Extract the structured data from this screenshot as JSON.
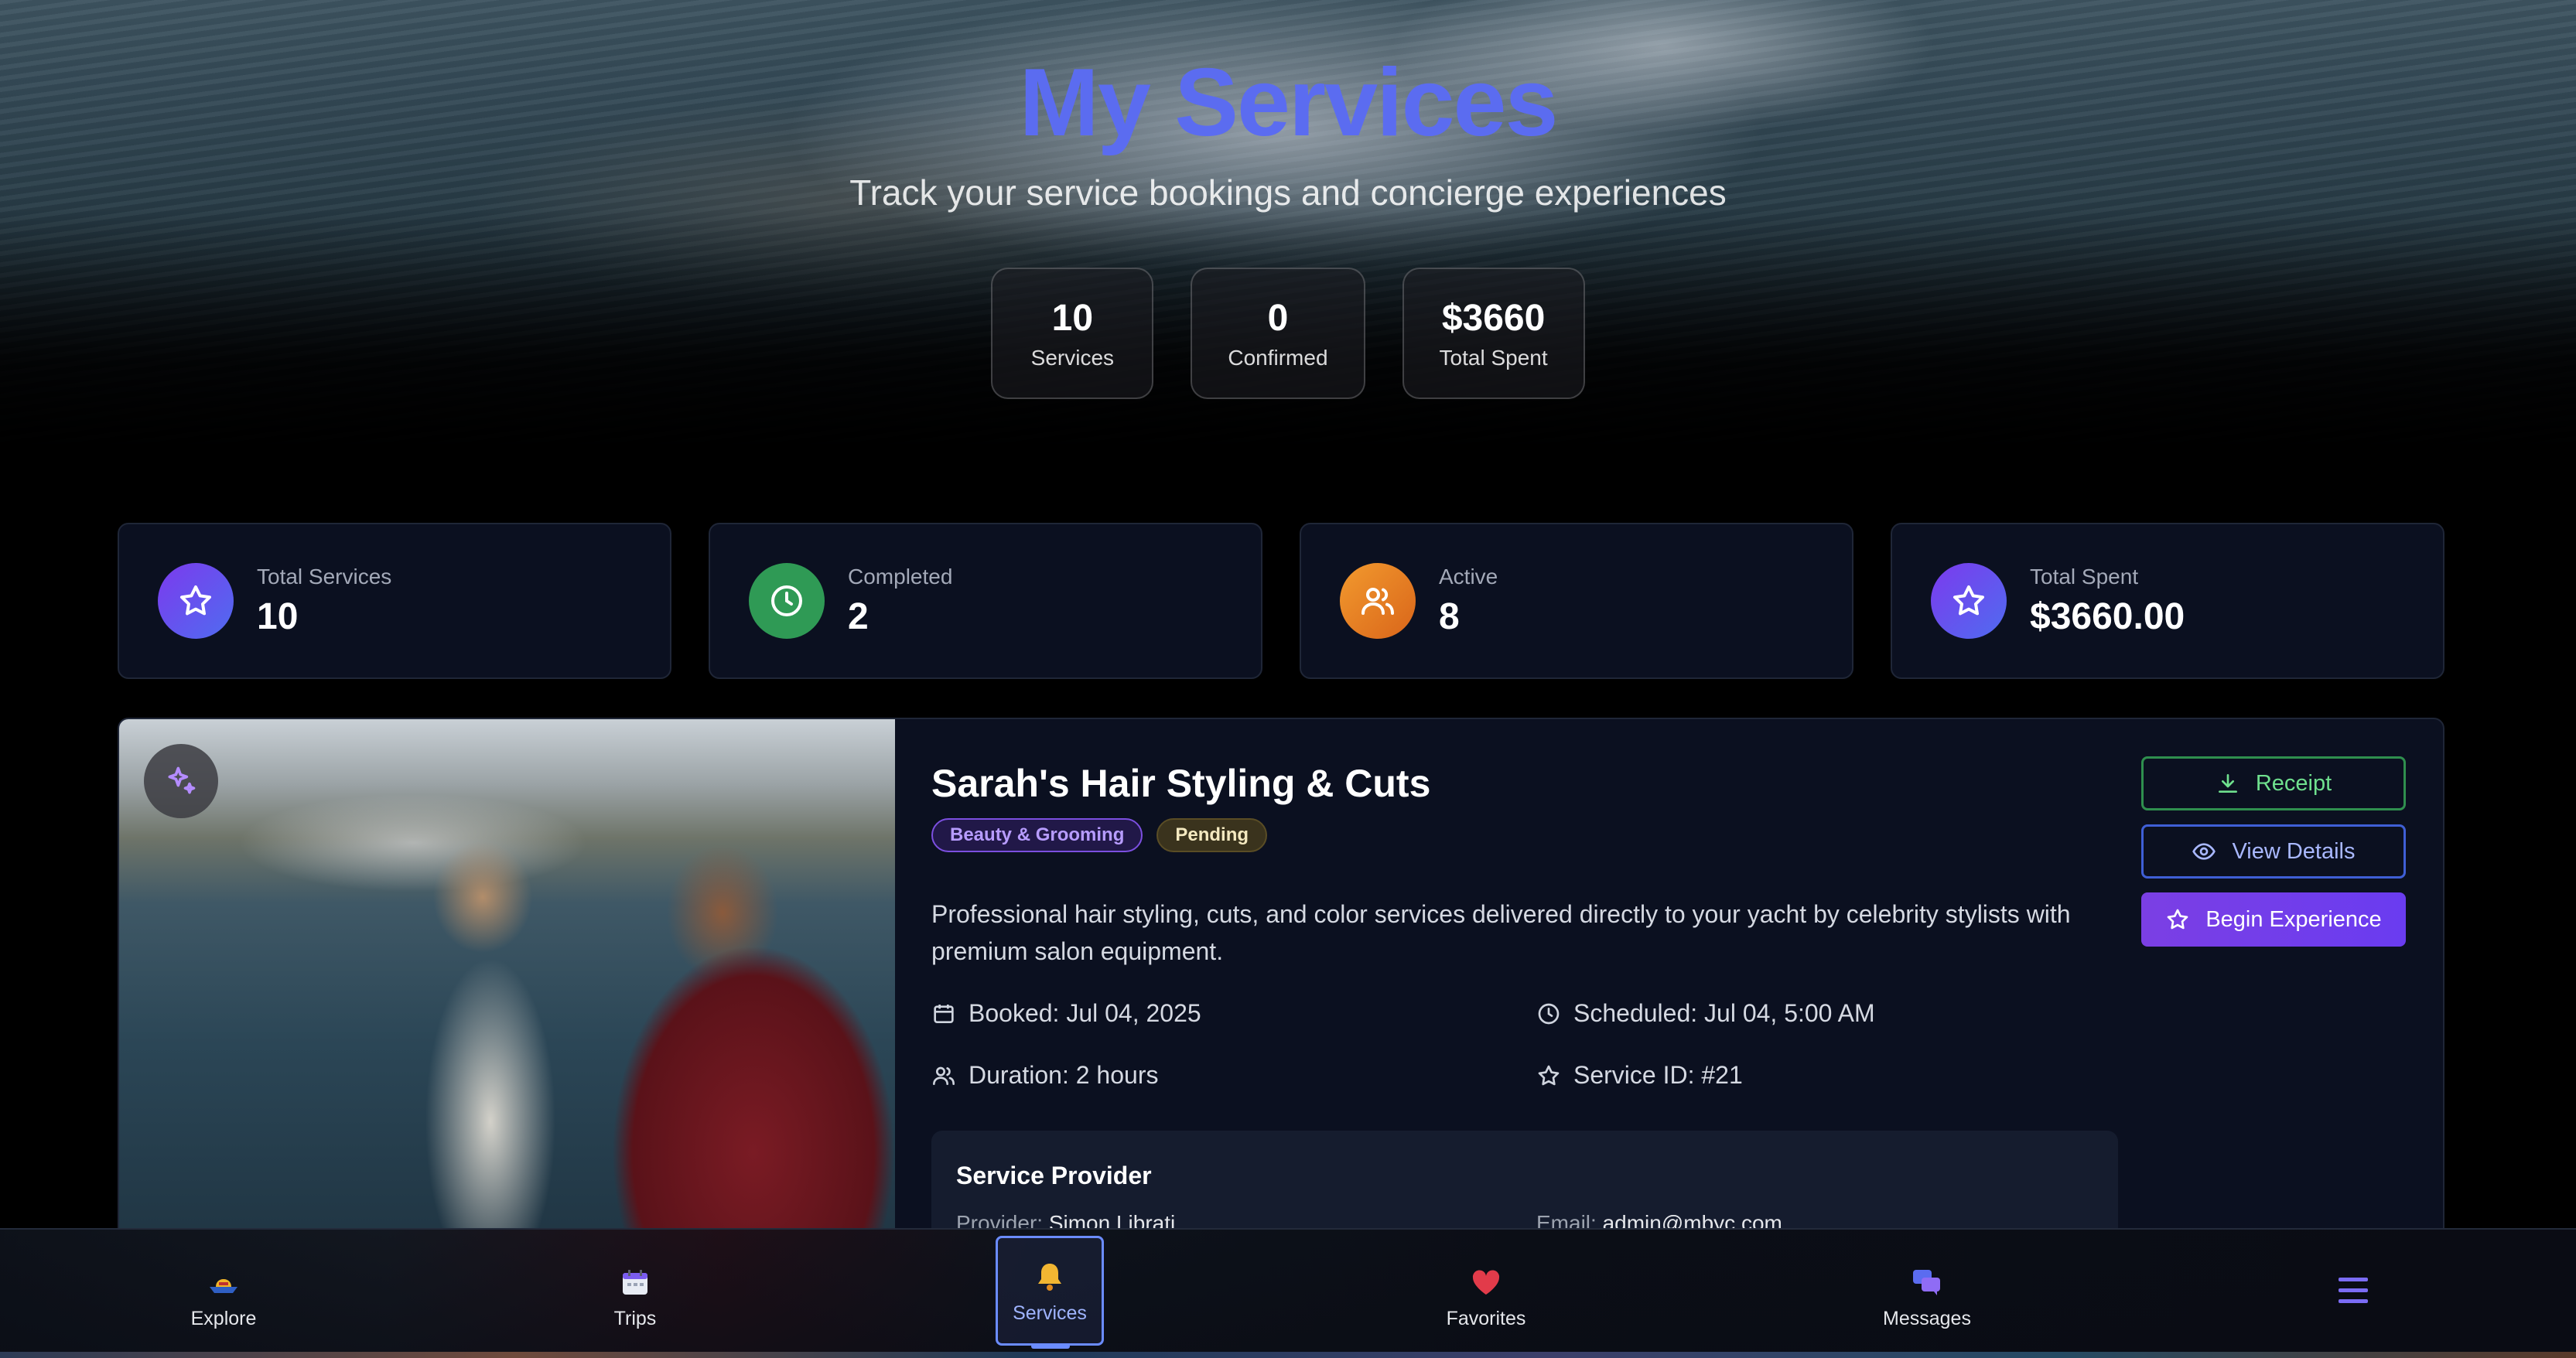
{
  "hero": {
    "title": "My Services",
    "subtitle": "Track your service bookings and concierge experiences",
    "stats": [
      {
        "value": "10",
        "label": "Services"
      },
      {
        "value": "0",
        "label": "Confirmed"
      },
      {
        "value": "$3660",
        "label": "Total Spent"
      }
    ]
  },
  "summary": [
    {
      "label": "Total Services",
      "value": "10",
      "icon": "star-icon",
      "color": "#6d4df0"
    },
    {
      "label": "Completed",
      "value": "2",
      "icon": "clock-icon",
      "color": "#2f9a55"
    },
    {
      "label": "Active",
      "value": "8",
      "icon": "users-icon",
      "color": "#e0801f"
    },
    {
      "label": "Total Spent",
      "value": "$3660.00",
      "icon": "star-icon",
      "color": "#6d4df0"
    }
  ],
  "service": {
    "title": "Sarah's Hair Styling & Cuts",
    "category": "Beauty & Grooming",
    "status": "Pending",
    "description": "Professional hair styling, cuts, and color services delivered directly to your yacht by celebrity stylists with premium salon equipment.",
    "booked": "Booked: Jul 04, 2025",
    "scheduled": "Scheduled: Jul 04, 5:00 AM",
    "duration": "Duration: 2 hours",
    "service_id": "Service ID: #21",
    "provider": {
      "heading": "Service Provider",
      "provider_label": "Provider:",
      "provider_name": "Simon Librati",
      "email_label": "Email:",
      "email": "admin@mbyc.com"
    },
    "actions": {
      "receipt": "Receipt",
      "view_details": "View Details",
      "begin": "Begin Experience"
    }
  },
  "nav": {
    "items": [
      {
        "label": "Explore",
        "icon": "yacht-icon"
      },
      {
        "label": "Trips",
        "icon": "calendar-icon"
      },
      {
        "label": "Services",
        "icon": "bell-icon",
        "active": true
      },
      {
        "label": "Favorites",
        "icon": "heart-icon"
      },
      {
        "label": "Messages",
        "icon": "chat-icon"
      }
    ],
    "menu_icon": "hamburger-icon",
    "accent": "#6b8cff"
  }
}
